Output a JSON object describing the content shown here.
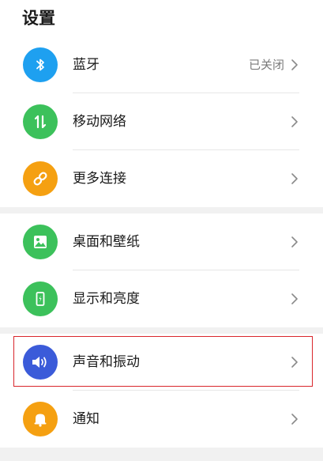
{
  "page": {
    "title": "设置"
  },
  "groups": [
    {
      "items": [
        {
          "label": "蓝牙",
          "value": "已关闭",
          "icon": "bluetooth-icon",
          "color": "#1ea0f0"
        },
        {
          "label": "移动网络",
          "value": "",
          "icon": "mobile-data-icon",
          "color": "#3cc15b"
        },
        {
          "label": "更多连接",
          "value": "",
          "icon": "link-icon",
          "color": "#f5a011"
        }
      ]
    },
    {
      "items": [
        {
          "label": "桌面和壁纸",
          "value": "",
          "icon": "wallpaper-icon",
          "color": "#3cc15b"
        },
        {
          "label": "显示和亮度",
          "value": "",
          "icon": "display-icon",
          "color": "#3cc15b"
        }
      ]
    },
    {
      "items": [
        {
          "label": "声音和振动",
          "value": "",
          "icon": "sound-icon",
          "color": "#3b5bd9",
          "highlighted": true
        },
        {
          "label": "通知",
          "value": "",
          "icon": "notification-icon",
          "color": "#f5a011"
        }
      ]
    }
  ],
  "colors": {
    "background": "#ffffff",
    "separator": "#f1f1f1",
    "highlight_border": "#d9262c"
  }
}
